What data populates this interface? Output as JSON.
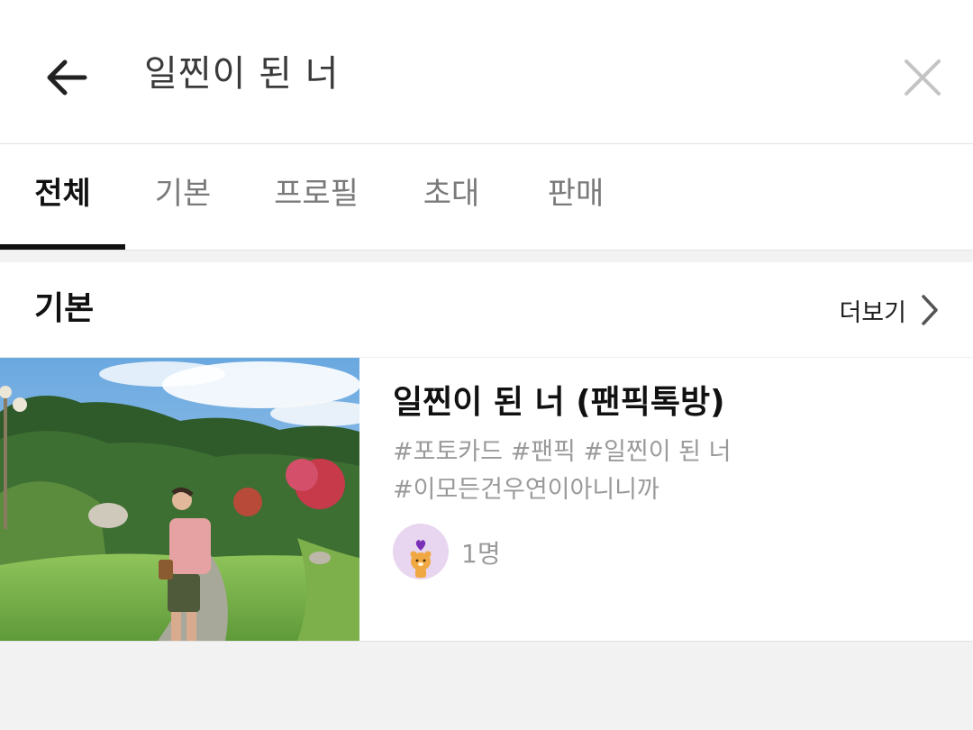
{
  "header": {
    "search_query": "일찐이 된 너",
    "back_icon": "arrow-left-icon",
    "clear_icon": "close-icon"
  },
  "tabs": [
    {
      "label": "전체",
      "active": true
    },
    {
      "label": "기본",
      "active": false
    },
    {
      "label": "프로필",
      "active": false
    },
    {
      "label": "초대",
      "active": false
    },
    {
      "label": "판매",
      "active": false
    }
  ],
  "section": {
    "title": "기본",
    "more_label": "더보기",
    "more_icon": "chevron-right-icon"
  },
  "result": {
    "title": "일찐이 된 너 (팬픽톡방)",
    "tags_line1": "#포토카드 #팬픽 #일찐이 된 너",
    "tags_line2": "#이모든건우연이아니니까",
    "member_count": "1명",
    "avatar_icon": "ryan-character-icon"
  },
  "colors": {
    "active_tab": "#111111",
    "inactive_tab": "#7a7a7a",
    "tag_text": "#9a9a9a",
    "avatar_bg": "#e8d6f0",
    "background": "#f2f2f2"
  }
}
